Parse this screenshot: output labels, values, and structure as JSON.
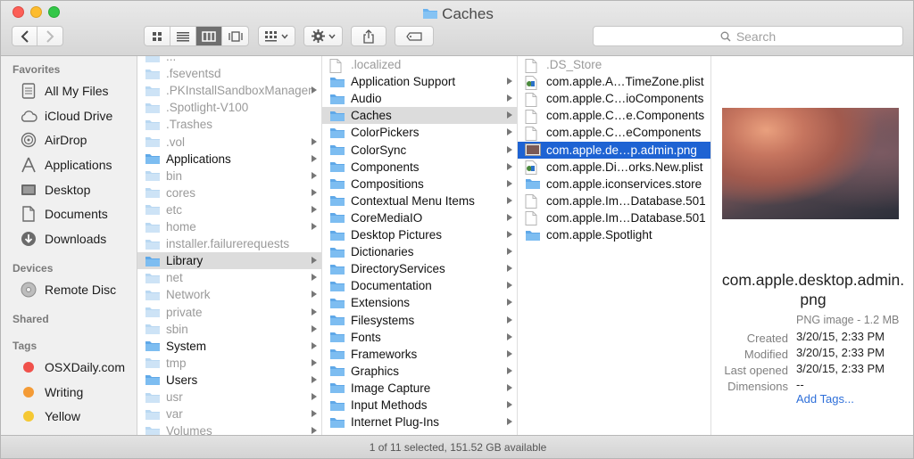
{
  "window": {
    "title": "Caches"
  },
  "search": {
    "placeholder": "Search"
  },
  "sidebar": {
    "favorites_header": "Favorites",
    "favorites": [
      {
        "label": "All My Files",
        "icon": "all-files-icon"
      },
      {
        "label": "iCloud Drive",
        "icon": "cloud-icon"
      },
      {
        "label": "AirDrop",
        "icon": "airdrop-icon"
      },
      {
        "label": "Applications",
        "icon": "applications-icon"
      },
      {
        "label": "Desktop",
        "icon": "desktop-icon"
      },
      {
        "label": "Documents",
        "icon": "documents-icon"
      },
      {
        "label": "Downloads",
        "icon": "downloads-icon"
      }
    ],
    "devices_header": "Devices",
    "devices": [
      {
        "label": "Remote Disc",
        "icon": "disc-icon"
      }
    ],
    "shared_header": "Shared",
    "tags_header": "Tags",
    "tags": [
      {
        "label": "OSXDaily.com",
        "color": "#f0514b"
      },
      {
        "label": "Writing",
        "color": "#f49b36"
      },
      {
        "label": "Yellow",
        "color": "#f5c833"
      }
    ]
  },
  "columns": {
    "root": [
      {
        "name": "...",
        "dim": true,
        "arrow": false
      },
      {
        "name": ".fseventsd",
        "dim": true,
        "arrow": false
      },
      {
        "name": ".PKInstallSandboxManager",
        "dim": true,
        "arrow": true
      },
      {
        "name": ".Spotlight-V100",
        "dim": true,
        "arrow": false
      },
      {
        "name": ".Trashes",
        "dim": true,
        "arrow": false
      },
      {
        "name": ".vol",
        "dim": true,
        "arrow": true
      },
      {
        "name": "Applications",
        "dim": false,
        "arrow": true
      },
      {
        "name": "bin",
        "dim": true,
        "arrow": true
      },
      {
        "name": "cores",
        "dim": true,
        "arrow": true
      },
      {
        "name": "etc",
        "dim": true,
        "arrow": true
      },
      {
        "name": "home",
        "dim": true,
        "arrow": true
      },
      {
        "name": "installer.failurerequests",
        "dim": true,
        "arrow": false
      },
      {
        "name": "Library",
        "dim": false,
        "arrow": true,
        "selected": true
      },
      {
        "name": "net",
        "dim": true,
        "arrow": true
      },
      {
        "name": "Network",
        "dim": true,
        "arrow": true
      },
      {
        "name": "private",
        "dim": true,
        "arrow": true
      },
      {
        "name": "sbin",
        "dim": true,
        "arrow": true
      },
      {
        "name": "System",
        "dim": false,
        "arrow": true
      },
      {
        "name": "tmp",
        "dim": true,
        "arrow": true
      },
      {
        "name": "Users",
        "dim": false,
        "arrow": true
      },
      {
        "name": "usr",
        "dim": true,
        "arrow": true
      },
      {
        "name": "var",
        "dim": true,
        "arrow": true
      },
      {
        "name": "Volumes",
        "dim": true,
        "arrow": true
      }
    ],
    "library": [
      {
        "name": ".localized",
        "dim": true,
        "arrow": false,
        "kind": "file"
      },
      {
        "name": "Application Support",
        "arrow": true
      },
      {
        "name": "Audio",
        "arrow": true
      },
      {
        "name": "Caches",
        "arrow": true,
        "selected": true
      },
      {
        "name": "ColorPickers",
        "arrow": true
      },
      {
        "name": "ColorSync",
        "arrow": true
      },
      {
        "name": "Components",
        "arrow": true
      },
      {
        "name": "Compositions",
        "arrow": true
      },
      {
        "name": "Contextual Menu Items",
        "arrow": true
      },
      {
        "name": "CoreMediaIO",
        "arrow": true
      },
      {
        "name": "Desktop Pictures",
        "arrow": true
      },
      {
        "name": "Dictionaries",
        "arrow": true
      },
      {
        "name": "DirectoryServices",
        "arrow": true
      },
      {
        "name": "Documentation",
        "arrow": true
      },
      {
        "name": "Extensions",
        "arrow": true
      },
      {
        "name": "Filesystems",
        "arrow": true
      },
      {
        "name": "Fonts",
        "arrow": true
      },
      {
        "name": "Frameworks",
        "arrow": true
      },
      {
        "name": "Graphics",
        "arrow": true
      },
      {
        "name": "Image Capture",
        "arrow": true
      },
      {
        "name": "Input Methods",
        "arrow": true
      },
      {
        "name": "Internet Plug-Ins",
        "arrow": true
      },
      {
        "name": "",
        "arrow": true
      }
    ],
    "caches": [
      {
        "name": ".DS_Store",
        "dim": true,
        "kind": "file"
      },
      {
        "name": "com.apple.A…TimeZone.plist",
        "kind": "plist"
      },
      {
        "name": "com.apple.C…ioComponents",
        "kind": "file"
      },
      {
        "name": "com.apple.C…e.Components",
        "kind": "file"
      },
      {
        "name": "com.apple.C…eComponents",
        "kind": "file"
      },
      {
        "name": "com.apple.de…p.admin.png",
        "kind": "image",
        "selected": true
      },
      {
        "name": "com.apple.Di…orks.New.plist",
        "kind": "plist"
      },
      {
        "name": "com.apple.iconservices.store",
        "kind": "folder"
      },
      {
        "name": "com.apple.Im…Database.501",
        "kind": "file"
      },
      {
        "name": "com.apple.Im…Database.501",
        "kind": "file"
      },
      {
        "name": "com.apple.Spotlight",
        "kind": "folder"
      }
    ]
  },
  "preview": {
    "filename": "com.apple.desktop.admin.png",
    "type": "PNG image - 1.2 MB",
    "created_label": "Created",
    "created": "3/20/15, 2:33 PM",
    "modified_label": "Modified",
    "modified": "3/20/15, 2:33 PM",
    "last_opened_label": "Last opened",
    "last_opened": "3/20/15, 2:33 PM",
    "dimensions_label": "Dimensions",
    "dimensions": "--",
    "add_tags": "Add Tags..."
  },
  "status": {
    "text": "1 of 11 selected, 151.52 GB available"
  },
  "colors": {
    "folder": "#6ab3f0",
    "selection": "#1e63d3"
  }
}
